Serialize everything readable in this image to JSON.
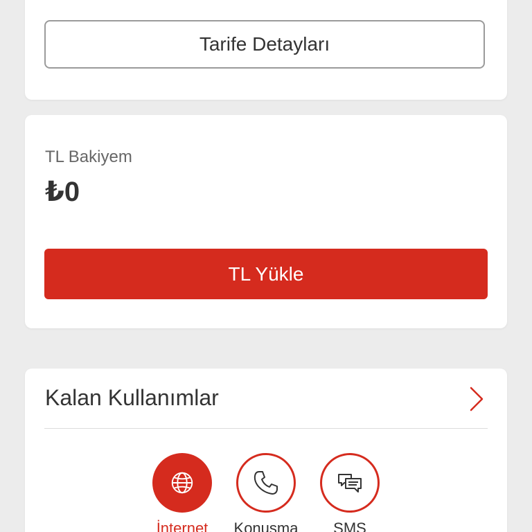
{
  "colors": {
    "accent": "#d52b1e",
    "background": "#ececec",
    "card": "#ffffff",
    "text": "#333333"
  },
  "plan_card": {
    "details_button": "Tarife Detayları"
  },
  "balance_card": {
    "label": "TL Bakiyem",
    "value": "₺0",
    "topup_button": "TL Yükle"
  },
  "usage_card": {
    "title": "Kalan Kullanımlar",
    "chevron_icon": "chevron-right-icon",
    "tabs": [
      {
        "label": "İnternet",
        "icon": "globe-icon",
        "active": true
      },
      {
        "label": "Konuşma",
        "icon": "phone-icon",
        "active": false
      },
      {
        "label": "SMS",
        "icon": "chat-bubbles-icon",
        "active": false
      }
    ]
  }
}
